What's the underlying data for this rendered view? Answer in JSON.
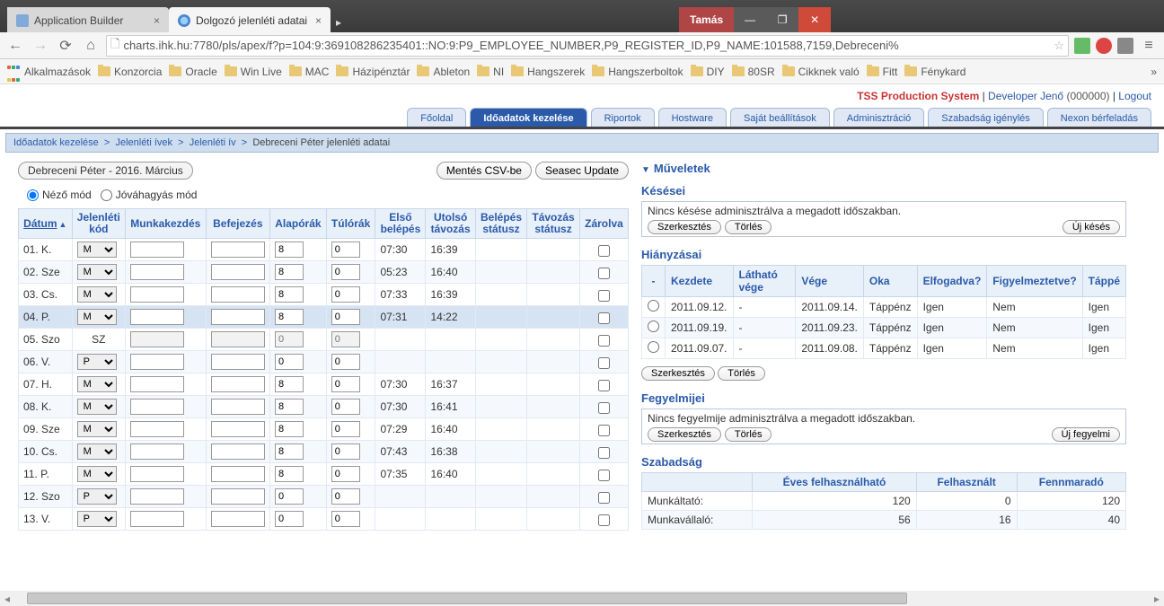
{
  "browser": {
    "tabs": [
      {
        "title": "Application Builder",
        "active": false
      },
      {
        "title": "Dolgozó jelenléti adatai",
        "active": true
      }
    ],
    "user_chip": "Tamás",
    "url": "charts.ihk.hu:7780/pls/apex/f?p=104:9:369108286235401::NO:9:P9_EMPLOYEE_NUMBER,P9_REGISTER_ID,P9_NAME:101588,7159,Debreceni%"
  },
  "bookmarks": [
    "Alkalmazások",
    "Konzorcia",
    "Oracle",
    "Win Live",
    "MAC",
    "Házipénztár",
    "Ableton",
    "NI",
    "Hangszerek",
    "Hangszerboltok",
    "DIY",
    "80SR",
    "Cikknek való",
    "Fitt",
    "Fénykard"
  ],
  "header": {
    "system": "TSS Production System",
    "developer": "Developer Jenő",
    "developer_id": "(000000)",
    "logout": "Logout"
  },
  "navtabs": [
    "Főoldal",
    "Időadatok kezelése",
    "Riportok",
    "Hostware",
    "Saját beállítások",
    "Adminisztráció",
    "Szabadság igénylés",
    "Nexon bérfeladás"
  ],
  "navtab_selected": 1,
  "breadcrumb": [
    "Időadatok kezelése",
    "Jelenléti ívek",
    "Jelenléti ív",
    "Debreceni Péter jelenléti adatai"
  ],
  "pill": "Debreceni Péter - 2016. Március",
  "buttons": {
    "csv": "Mentés CSV-be",
    "seasec": "Seasec Update"
  },
  "modes": {
    "view": "Néző mód",
    "approve": "Jóváhagyás mód"
  },
  "grid": {
    "headers": [
      "Dátum",
      "Jelenléti kód",
      "Munkakezdés",
      "Befejezés",
      "Alapórák",
      "Túlórák",
      "Első belépés",
      "Utolsó távozás",
      "Belépés státusz",
      "Távozás státusz",
      "Zárolva"
    ],
    "rows": [
      {
        "d": "01. K.",
        "code": "M",
        "alap": "8",
        "tul": "0",
        "be": "07:30",
        "ki": "16:39",
        "lock": false,
        "hl": false,
        "dis": false
      },
      {
        "d": "02. Sze",
        "code": "M",
        "alap": "8",
        "tul": "0",
        "be": "05:23",
        "ki": "16:40",
        "lock": false,
        "hl": false,
        "dis": false
      },
      {
        "d": "03. Cs.",
        "code": "M",
        "alap": "8",
        "tul": "0",
        "be": "07:33",
        "ki": "16:39",
        "lock": false,
        "hl": false,
        "dis": false
      },
      {
        "d": "04. P.",
        "code": "M",
        "alap": "8",
        "tul": "0",
        "be": "07:31",
        "ki": "14:22",
        "lock": false,
        "hl": true,
        "dis": false
      },
      {
        "d": "05. Szo",
        "code": "SZ",
        "alap": "0",
        "tul": "0",
        "be": "",
        "ki": "",
        "lock": false,
        "hl": false,
        "dis": true,
        "text": true
      },
      {
        "d": "06. V.",
        "code": "P",
        "alap": "0",
        "tul": "0",
        "be": "",
        "ki": "",
        "lock": false,
        "hl": false,
        "dis": false
      },
      {
        "d": "07. H.",
        "code": "M",
        "alap": "8",
        "tul": "0",
        "be": "07:30",
        "ki": "16:37",
        "lock": false,
        "hl": false,
        "dis": false
      },
      {
        "d": "08. K.",
        "code": "M",
        "alap": "8",
        "tul": "0",
        "be": "07:30",
        "ki": "16:41",
        "lock": false,
        "hl": false,
        "dis": false
      },
      {
        "d": "09. Sze",
        "code": "M",
        "alap": "8",
        "tul": "0",
        "be": "07:29",
        "ki": "16:40",
        "lock": false,
        "hl": false,
        "dis": false
      },
      {
        "d": "10. Cs.",
        "code": "M",
        "alap": "8",
        "tul": "0",
        "be": "07:43",
        "ki": "16:38",
        "lock": false,
        "hl": false,
        "dis": false
      },
      {
        "d": "11. P.",
        "code": "M",
        "alap": "8",
        "tul": "0",
        "be": "07:35",
        "ki": "16:40",
        "lock": false,
        "hl": false,
        "dis": false
      },
      {
        "d": "12. Szo",
        "code": "P",
        "alap": "0",
        "tul": "0",
        "be": "",
        "ki": "",
        "lock": false,
        "hl": false,
        "dis": false
      },
      {
        "d": "13. V.",
        "code": "P",
        "alap": "0",
        "tul": "0",
        "be": "",
        "ki": "",
        "lock": false,
        "hl": false,
        "dis": false
      }
    ]
  },
  "ops_title": "Műveletek",
  "lateness": {
    "title": "Késései",
    "note": "Nincs késése adminisztrálva a megadott időszakban.",
    "btn_edit": "Szerkesztés",
    "btn_del": "Törlés",
    "btn_new": "Új késés"
  },
  "absences": {
    "title": "Hiányzásai",
    "headers": [
      "-",
      "Kezdete",
      "Látható vége",
      "Vége",
      "Oka",
      "Elfogadva?",
      "Figyelmeztetve?",
      "Táppé"
    ],
    "rows": [
      {
        "kezd": "2011.09.12.",
        "lat": "-",
        "vege": "2011.09.14.",
        "oka": "Táppénz",
        "elf": "Igen",
        "figy": "Nem",
        "tap": "Igen"
      },
      {
        "kezd": "2011.09.19.",
        "lat": "-",
        "vege": "2011.09.23.",
        "oka": "Táppénz",
        "elf": "Igen",
        "figy": "Nem",
        "tap": "Igen"
      },
      {
        "kezd": "2011.09.07.",
        "lat": "-",
        "vege": "2011.09.08.",
        "oka": "Táppénz",
        "elf": "Igen",
        "figy": "Nem",
        "tap": "Igen"
      }
    ],
    "btn_edit": "Szerkesztés",
    "btn_del": "Törlés"
  },
  "discipline": {
    "title": "Fegyelmijei",
    "note": "Nincs fegyelmije adminisztrálva a megadott időszakban.",
    "btn_edit": "Szerkesztés",
    "btn_del": "Törlés",
    "btn_new": "Új fegyelmi"
  },
  "vacation": {
    "title": "Szabadság",
    "headers": [
      "",
      "Éves felhasználható",
      "Felhasznált",
      "Fennmaradó"
    ],
    "rows": [
      {
        "label": "Munkáltató:",
        "a": "120",
        "b": "0",
        "c": "120"
      },
      {
        "label": "Munkavállaló:",
        "a": "56",
        "b": "16",
        "c": "40"
      }
    ]
  }
}
